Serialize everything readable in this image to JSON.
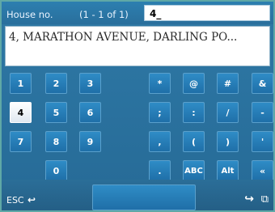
{
  "header": {
    "label": "House no.",
    "count": "(1 - 1 of 1)",
    "input_value": "4_"
  },
  "result": {
    "text": "4, MARATHON AVENUE, DARLING PO..."
  },
  "keys": {
    "k1": "1",
    "k2": "2",
    "k3": "3",
    "kstar": "*",
    "kat": "@",
    "khash": "#",
    "kamp": "&",
    "k4": "4",
    "k5": "5",
    "k6": "6",
    "ksemi": ";",
    "kcolon": ":",
    "kslash": "/",
    "kdash": "-",
    "k7": "7",
    "k8": "8",
    "k9": "9",
    "kcomma": ",",
    "klparen": "(",
    "krparen": ")",
    "kquote": "'",
    "k0": "0",
    "kdot": ".",
    "kabc": "ABC",
    "kalt": "Alt",
    "kback": "«"
  },
  "bottom": {
    "esc_label": "ESC"
  }
}
